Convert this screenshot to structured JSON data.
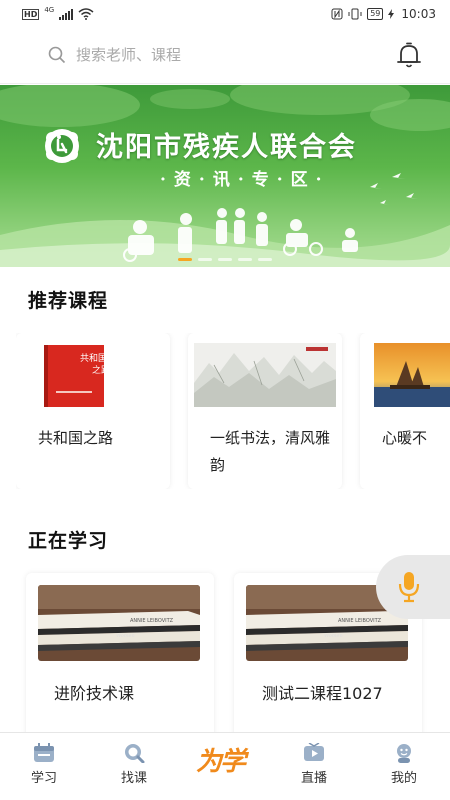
{
  "status_bar": {
    "hd": "HD",
    "network": "4G",
    "battery": "59",
    "time": "10:03"
  },
  "search": {
    "placeholder": "搜索老师、课程",
    "icon": "search-icon"
  },
  "header": {
    "notification_icon": "bell-icon"
  },
  "banner": {
    "title": "沈阳市残疾人联合会",
    "subtitle": "·资·讯·专·区·",
    "slide_count": 5,
    "active_slide": 1
  },
  "recommended": {
    "title": "推荐课程",
    "courses": [
      {
        "title": "共和国之路"
      },
      {
        "title": "一纸书法，清风雅韵"
      },
      {
        "title": "心暖不"
      }
    ]
  },
  "learning": {
    "title": "正在学习",
    "courses": [
      {
        "title": "进阶技术课"
      },
      {
        "title": "测试二课程1027"
      }
    ]
  },
  "bottom_nav": {
    "items": [
      {
        "label": "学习",
        "icon": "calendar-icon"
      },
      {
        "label": "找课",
        "icon": "search-course-icon"
      },
      {
        "label": "为学",
        "icon": "brand-logo"
      },
      {
        "label": "直播",
        "icon": "live-tv-icon"
      },
      {
        "label": "我的",
        "icon": "profile-icon"
      }
    ]
  },
  "colors": {
    "accent": "#f08a1c",
    "banner_green": "#4ea843",
    "mic": "#f5a623"
  }
}
